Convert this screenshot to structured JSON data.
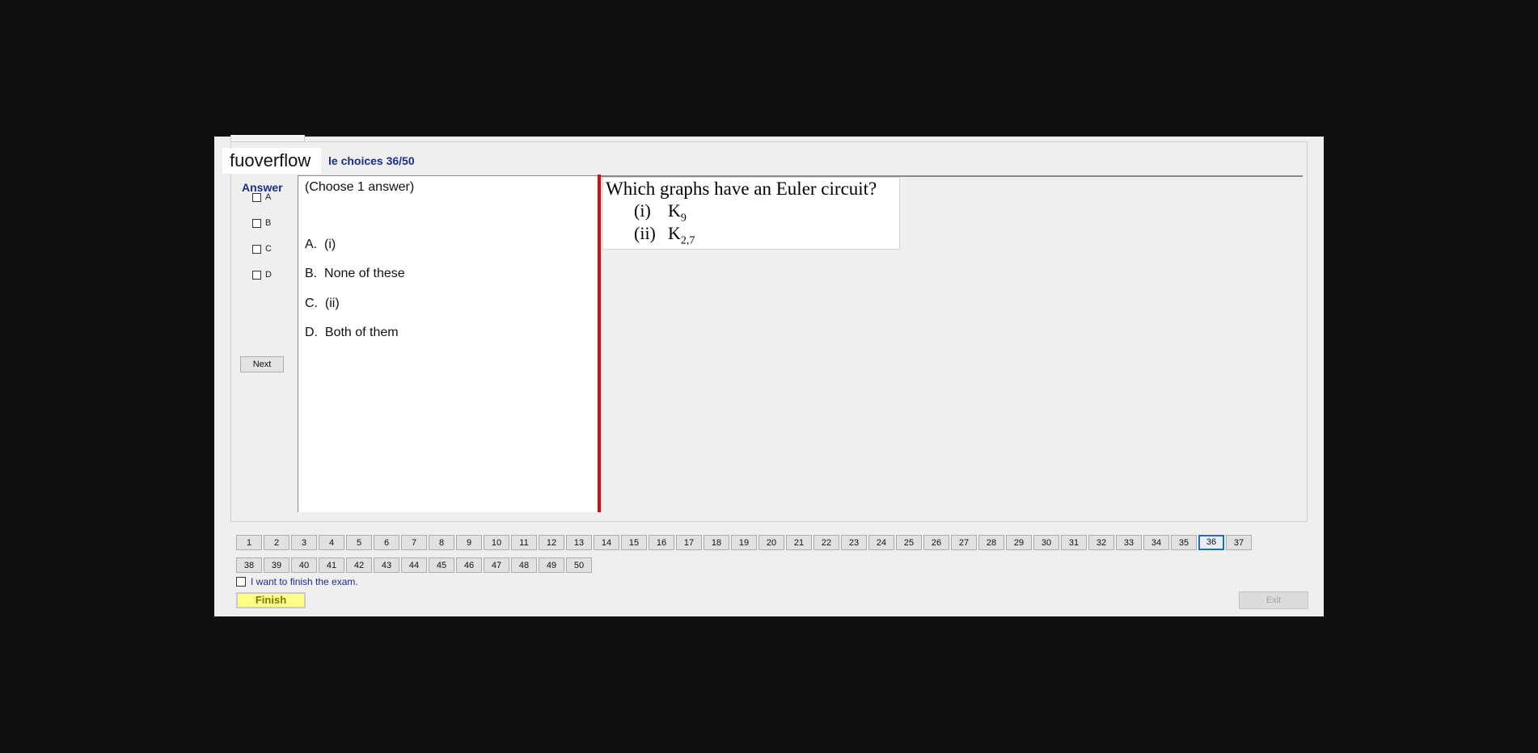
{
  "brand": "fuoverflow",
  "header": {
    "title": "le choices 36/50"
  },
  "answer_label": "Answer",
  "options": [
    "A",
    "B",
    "C",
    "D"
  ],
  "next_label": "Next",
  "answers": {
    "instruction": "(Choose 1 answer)",
    "choices": [
      {
        "letter": "A.",
        "text": "(i)"
      },
      {
        "letter": "B.",
        "text": "None of these"
      },
      {
        "letter": "C.",
        "text": "(ii)"
      },
      {
        "letter": "D.",
        "text": "Both of them"
      }
    ]
  },
  "question": {
    "text": "Which graphs have an Euler circuit?",
    "items": [
      {
        "num": "(i)",
        "base": "K",
        "sub": "9"
      },
      {
        "num": "(ii)",
        "base": "K",
        "sub": "2,7"
      }
    ]
  },
  "nav": {
    "row1": [
      "1",
      "2",
      "3",
      "4",
      "5",
      "6",
      "7",
      "8",
      "9",
      "10",
      "11",
      "12",
      "13",
      "14",
      "15",
      "16",
      "17",
      "18",
      "19",
      "20",
      "21",
      "22",
      "23",
      "24",
      "25",
      "26",
      "27",
      "28",
      "29",
      "30",
      "31",
      "32",
      "33",
      "34",
      "35",
      "36",
      "37"
    ],
    "row2": [
      "38",
      "39",
      "40",
      "41",
      "42",
      "43",
      "44",
      "45",
      "46",
      "47",
      "48",
      "49",
      "50"
    ],
    "current": "36"
  },
  "finish_checkbox_label": "I want to finish the exam.",
  "finish_label": "Finish",
  "exit_label": "Exit",
  "colors": {
    "accent": "#1a2e8c",
    "divider": "#d01010",
    "finish_bg": "#ffff88"
  }
}
